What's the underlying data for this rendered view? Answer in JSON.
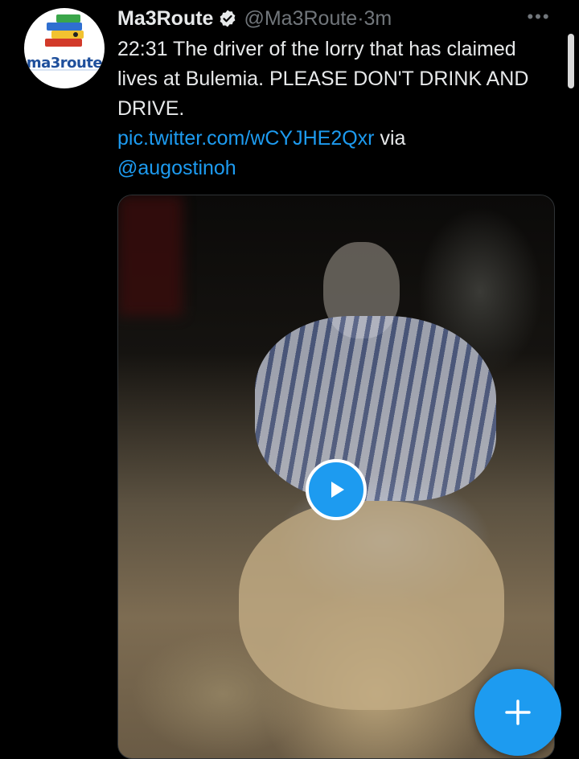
{
  "tweet": {
    "avatar_text": "ma3route",
    "display_name": "Ma3Route",
    "verified_icon": "verified-badge-icon",
    "handle": "@Ma3Route",
    "separator": " · ",
    "time": "3m",
    "more_icon": "more-options-icon",
    "text_line1": "22:31 The driver of the lorry that has claimed lives at Bulemia. PLEASE DON'T DRINK AND DRIVE.",
    "link": "pic.twitter.com/wCYJHE2Qxr",
    "via": " via",
    "mention": "@augostinoh",
    "play_icon": "play-icon"
  },
  "compose": {
    "icon": "plus-icon",
    "label": "+"
  },
  "colors": {
    "background": "#000000",
    "text": "#e7e9ea",
    "secondary": "#71767b",
    "accent": "#1d9bf0"
  }
}
